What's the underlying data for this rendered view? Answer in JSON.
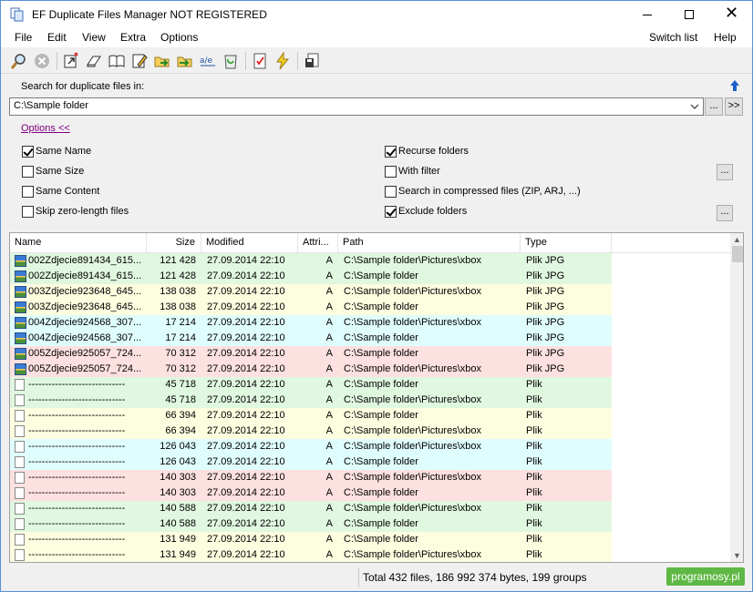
{
  "window": {
    "title": "EF Duplicate Files Manager NOT REGISTERED"
  },
  "menu": {
    "file": "File",
    "edit": "Edit",
    "view": "View",
    "extra": "Extra",
    "options": "Options",
    "switch_list": "Switch list",
    "help": "Help"
  },
  "search": {
    "label": "Search for duplicate files in:",
    "path": "C:\\Sample folder",
    "browse_label": "...",
    "more_label": ">>"
  },
  "options_link": "Options  <<",
  "options": {
    "same_name": {
      "label": "Same Name",
      "checked": true
    },
    "same_size": {
      "label": "Same Size",
      "checked": false
    },
    "same_content": {
      "label": "Same Content",
      "checked": false
    },
    "skip_zero": {
      "label": "Skip zero-length files",
      "checked": false
    },
    "recurse": {
      "label": "Recurse folders",
      "checked": true
    },
    "with_filter": {
      "label": "With filter",
      "checked": false
    },
    "compressed": {
      "label": "Search in compressed files (ZIP, ARJ, ...)",
      "checked": false
    },
    "exclude": {
      "label": "Exclude folders",
      "checked": true
    },
    "filter_btn": "...",
    "exclude_btn": "..."
  },
  "columns": {
    "name": "Name",
    "size": "Size",
    "modified": "Modified",
    "attr": "Attri...",
    "path": "Path",
    "type": "Type"
  },
  "colors": {
    "green": "#e0f7e0",
    "yellow": "#fdfde0",
    "cyan": "#e0fdfd",
    "pink": "#fde0e0",
    "watermark": "#5fb845"
  },
  "rows": [
    {
      "icon": "img",
      "name": "002Zdjecie891434_615...",
      "size": "121 428",
      "modified": "27.09.2014  22:10",
      "attr": "A",
      "path": "C:\\Sample folder\\Pictures\\xbox",
      "type": "Plik JPG",
      "color": "#e0f7e0"
    },
    {
      "icon": "img",
      "name": "002Zdjecie891434_615...",
      "size": "121 428",
      "modified": "27.09.2014  22:10",
      "attr": "A",
      "path": "C:\\Sample folder",
      "type": "Plik JPG",
      "color": "#e0f7e0"
    },
    {
      "icon": "img",
      "name": "003Zdjecie923648_645...",
      "size": "138 038",
      "modified": "27.09.2014  22:10",
      "attr": "A",
      "path": "C:\\Sample folder\\Pictures\\xbox",
      "type": "Plik JPG",
      "color": "#fdfde0"
    },
    {
      "icon": "img",
      "name": "003Zdjecie923648_645...",
      "size": "138 038",
      "modified": "27.09.2014  22:10",
      "attr": "A",
      "path": "C:\\Sample folder",
      "type": "Plik JPG",
      "color": "#fdfde0"
    },
    {
      "icon": "img",
      "name": "004Zdjecie924568_307...",
      "size": "17 214",
      "modified": "27.09.2014  22:10",
      "attr": "A",
      "path": "C:\\Sample folder\\Pictures\\xbox",
      "type": "Plik JPG",
      "color": "#e0fdfd"
    },
    {
      "icon": "img",
      "name": "004Zdjecie924568_307...",
      "size": "17 214",
      "modified": "27.09.2014  22:10",
      "attr": "A",
      "path": "C:\\Sample folder",
      "type": "Plik JPG",
      "color": "#e0fdfd"
    },
    {
      "icon": "img",
      "name": "005Zdjecie925057_724...",
      "size": "70 312",
      "modified": "27.09.2014  22:10",
      "attr": "A",
      "path": "C:\\Sample folder",
      "type": "Plik JPG",
      "color": "#fde0e0"
    },
    {
      "icon": "img",
      "name": "005Zdjecie925057_724...",
      "size": "70 312",
      "modified": "27.09.2014  22:10",
      "attr": "A",
      "path": "C:\\Sample folder\\Pictures\\xbox",
      "type": "Plik JPG",
      "color": "#fde0e0"
    },
    {
      "icon": "doc",
      "name": "-----------------------------",
      "size": "45 718",
      "modified": "27.09.2014  22:10",
      "attr": "A",
      "path": "C:\\Sample folder",
      "type": "Plik",
      "color": "#e0f7e0"
    },
    {
      "icon": "doc",
      "name": "-----------------------------",
      "size": "45 718",
      "modified": "27.09.2014  22:10",
      "attr": "A",
      "path": "C:\\Sample folder\\Pictures\\xbox",
      "type": "Plik",
      "color": "#e0f7e0"
    },
    {
      "icon": "doc",
      "name": "-----------------------------",
      "size": "66 394",
      "modified": "27.09.2014  22:10",
      "attr": "A",
      "path": "C:\\Sample folder",
      "type": "Plik",
      "color": "#fdfde0"
    },
    {
      "icon": "doc",
      "name": "-----------------------------",
      "size": "66 394",
      "modified": "27.09.2014  22:10",
      "attr": "A",
      "path": "C:\\Sample folder\\Pictures\\xbox",
      "type": "Plik",
      "color": "#fdfde0"
    },
    {
      "icon": "doc",
      "name": "-----------------------------",
      "size": "126 043",
      "modified": "27.09.2014  22:10",
      "attr": "A",
      "path": "C:\\Sample folder\\Pictures\\xbox",
      "type": "Plik",
      "color": "#e0fdfd"
    },
    {
      "icon": "doc",
      "name": "-----------------------------",
      "size": "126 043",
      "modified": "27.09.2014  22:10",
      "attr": "A",
      "path": "C:\\Sample folder",
      "type": "Plik",
      "color": "#e0fdfd"
    },
    {
      "icon": "doc",
      "name": "-----------------------------",
      "size": "140 303",
      "modified": "27.09.2014  22:10",
      "attr": "A",
      "path": "C:\\Sample folder\\Pictures\\xbox",
      "type": "Plik",
      "color": "#fde0e0"
    },
    {
      "icon": "doc",
      "name": "-----------------------------",
      "size": "140 303",
      "modified": "27.09.2014  22:10",
      "attr": "A",
      "path": "C:\\Sample folder",
      "type": "Plik",
      "color": "#fde0e0"
    },
    {
      "icon": "doc",
      "name": "-----------------------------",
      "size": "140 588",
      "modified": "27.09.2014  22:10",
      "attr": "A",
      "path": "C:\\Sample folder\\Pictures\\xbox",
      "type": "Plik",
      "color": "#e0f7e0"
    },
    {
      "icon": "doc",
      "name": "-----------------------------",
      "size": "140 588",
      "modified": "27.09.2014  22:10",
      "attr": "A",
      "path": "C:\\Sample folder",
      "type": "Plik",
      "color": "#e0f7e0"
    },
    {
      "icon": "doc",
      "name": "-----------------------------",
      "size": "131 949",
      "modified": "27.09.2014  22:10",
      "attr": "A",
      "path": "C:\\Sample folder",
      "type": "Plik",
      "color": "#fdfde0"
    },
    {
      "icon": "doc",
      "name": "-----------------------------",
      "size": "131 949",
      "modified": "27.09.2014  22:10",
      "attr": "A",
      "path": "C:\\Sample folder\\Pictures\\xbox",
      "type": "Plik",
      "color": "#fdfde0"
    }
  ],
  "status": "Total 432 files, 186 992 374 bytes, 199 groups",
  "watermark": "programosy.pl"
}
